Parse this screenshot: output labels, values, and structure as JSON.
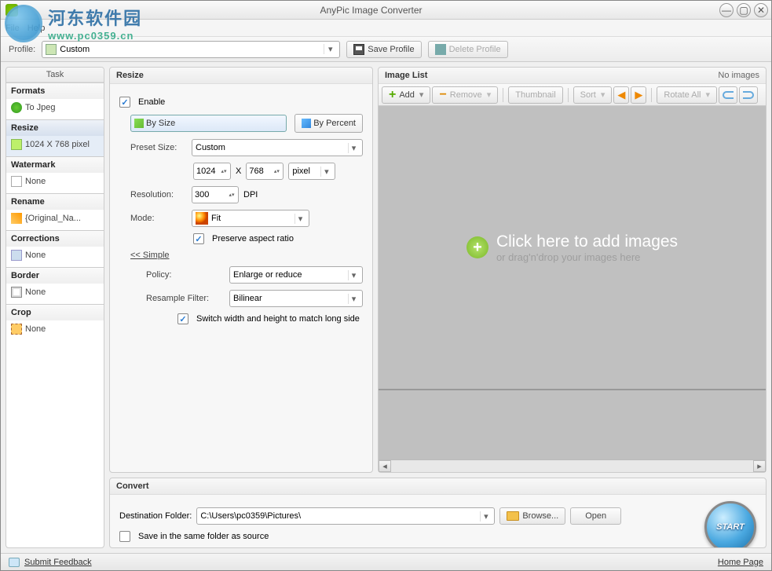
{
  "title": "AnyPic Image Converter",
  "menu": {
    "file": "File",
    "help": "Help"
  },
  "watermark": {
    "cn": "河东软件园",
    "url": "www.pc0359.cn"
  },
  "profile": {
    "label": "Profile:",
    "value": "Custom",
    "save": "Save Profile",
    "delete": "Delete Profile"
  },
  "task": {
    "header": "Task",
    "formats": {
      "title": "Formats",
      "value": "To Jpeg"
    },
    "resize": {
      "title": "Resize",
      "value": "1024 X 768 pixel"
    },
    "watermark": {
      "title": "Watermark",
      "value": "None"
    },
    "rename": {
      "title": "Rename",
      "value": "{Original_Na..."
    },
    "corrections": {
      "title": "Corrections",
      "value": "None"
    },
    "border": {
      "title": "Border",
      "value": "None"
    },
    "crop": {
      "title": "Crop",
      "value": "None"
    }
  },
  "resize": {
    "title": "Resize",
    "enable": "Enable",
    "by_size": "By Size",
    "by_percent": "By Percent",
    "preset_label": "Preset Size:",
    "preset_value": "Custom",
    "width": "1024",
    "x": "X",
    "height": "768",
    "unit": "pixel",
    "resolution_label": "Resolution:",
    "resolution_value": "300",
    "resolution_unit": "DPI",
    "mode_label": "Mode:",
    "mode_value": "Fit",
    "preserve": "Preserve aspect ratio",
    "simple": "<< Simple",
    "policy_label": "Policy:",
    "policy_value": "Enlarge or reduce",
    "filter_label": "Resample Filter:",
    "filter_value": "Bilinear",
    "switch": "Switch width and height to match long side"
  },
  "imglist": {
    "title": "Image List",
    "status": "No images",
    "add": "Add",
    "remove": "Remove",
    "thumbnail": "Thumbnail",
    "sort": "Sort",
    "rotate": "Rotate All",
    "drop1": "Click here  to add images",
    "drop2": "or drag'n'drop your images here"
  },
  "convert": {
    "title": "Convert",
    "dest_label": "Destination Folder:",
    "dest_value": "C:\\Users\\pc0359\\Pictures\\",
    "browse": "Browse...",
    "open": "Open",
    "same": "Save in the same folder as source",
    "start": "START"
  },
  "status": {
    "feedback": "Submit Feedback",
    "home": "Home Page"
  }
}
